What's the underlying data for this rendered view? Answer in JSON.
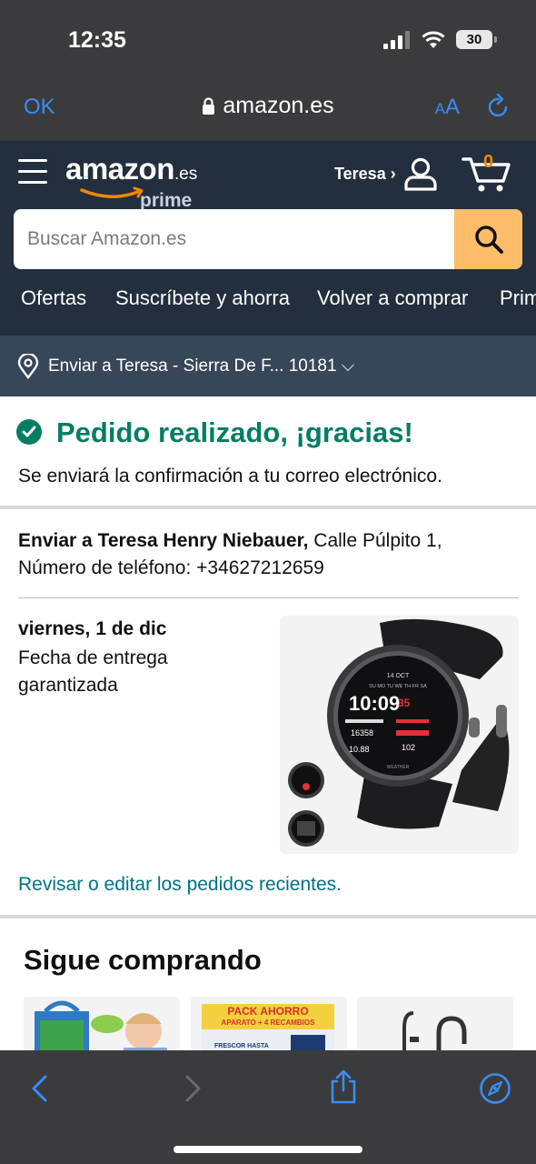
{
  "status_bar": {
    "time": "12:35",
    "battery": "30"
  },
  "browser": {
    "ok_label": "OK",
    "url": "amazon.es",
    "aa_label_small": "A",
    "aa_label_large": "A"
  },
  "header": {
    "logo_text": "amazon",
    "logo_tld": ".es",
    "logo_prime": "prime",
    "account_label": "Teresa ›",
    "cart_count": "0",
    "search_placeholder": "Buscar Amazon.es",
    "nav_links": [
      "Ofertas",
      "Suscríbete y ahorra",
      "Volver a comprar",
      "Prime"
    ]
  },
  "deliver_bar": {
    "text": "Enviar a Teresa - Sierra De F... 10181 ⌵"
  },
  "confirmation": {
    "title": "Pedido realizado, ¡gracias!",
    "subtitle": "Se enviará la confirmación a tu correo electrónico."
  },
  "shipping": {
    "name_bold": "Enviar a Teresa Henry Niebauer,",
    "address": " Calle Púlpito 1,",
    "phone": "Número de teléfono: +34627212659"
  },
  "delivery": {
    "date": "viernes, 1 de dic",
    "desc": "Fecha de entrega garantizada"
  },
  "watch_screen": {
    "date": "14 OCT",
    "days": "SU MO TU WE TH FR SA",
    "time": "10:09",
    "seconds": "35",
    "steps": "16358",
    "distance": "10.88",
    "heart": "102",
    "weather": "WEATHER"
  },
  "review_link": "Revisar o editar los pedidos recientes.",
  "keep_shopping": {
    "title": "Sigue comprando",
    "pack_title": "PACK AHORRO",
    "pack_sub": "APARATO + 4 RECAMBIOS",
    "pack_label": "FRESCOR HASTA"
  },
  "colors": {
    "header": "#232f3e",
    "deliver_bar": "#37475a",
    "success": "#067d62",
    "link": "#007185",
    "search_button": "#febd69",
    "ios_blue": "#3b8cf3"
  }
}
